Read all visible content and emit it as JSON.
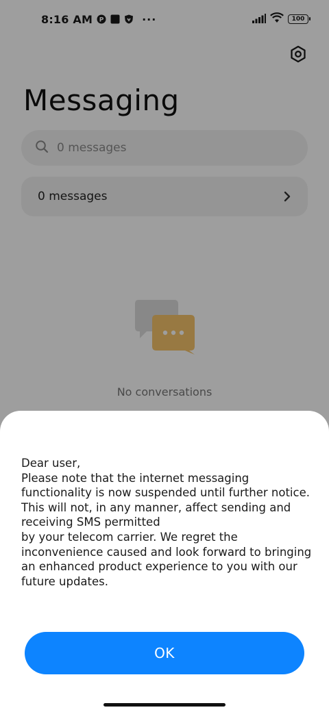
{
  "status_bar": {
    "time": "8:16 AM",
    "more": "···",
    "battery": "100",
    "icons": [
      "p-badge-icon",
      "square-icon",
      "shield-icon",
      "signal-icon",
      "wifi-icon",
      "battery-icon"
    ]
  },
  "header": {
    "title": "Messaging",
    "settings_icon": "settings-icon"
  },
  "search": {
    "placeholder": "0 messages",
    "icon": "search-icon"
  },
  "list_row": {
    "label": "0 messages",
    "icon": "chevron-right-icon"
  },
  "empty_state": {
    "icon": "chat-bubbles-icon",
    "text": "No conversations"
  },
  "dialog": {
    "message": "Dear user,\nPlease note that the internet messaging functionality is now suspended until further notice. This will not, in any manner, affect sending and receiving SMS permitted\nby your telecom carrier. We regret the inconvenience caused and look forward to bringing an enhanced product experience to you with our future updates.",
    "ok_label": "OK"
  },
  "colors": {
    "accent": "#0d84ff",
    "scrim": "rgba(0,0,0,0.38)",
    "field_bg": "#f1f1f1",
    "empty_icon_back": "#dcdcdc",
    "empty_icon_front": "#f5c46b"
  }
}
